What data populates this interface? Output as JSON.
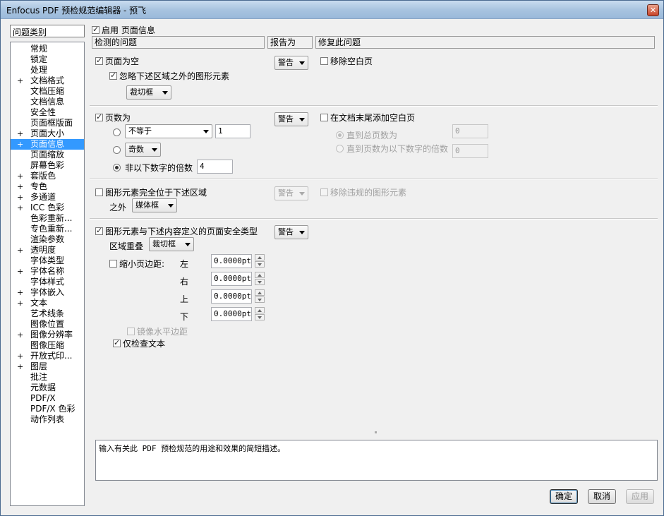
{
  "window": {
    "title": "Enfocus PDF 预检规范编辑器 - 预飞"
  },
  "sidebar": {
    "header": "问题类别",
    "items": [
      {
        "label": "常规",
        "exp": ""
      },
      {
        "label": "锁定",
        "exp": ""
      },
      {
        "label": "处理",
        "exp": ""
      },
      {
        "label": "文档格式",
        "exp": "+"
      },
      {
        "label": "文档压缩",
        "exp": ""
      },
      {
        "label": "文档信息",
        "exp": ""
      },
      {
        "label": "安全性",
        "exp": ""
      },
      {
        "label": "页面框版面",
        "exp": ""
      },
      {
        "label": "页面大小",
        "exp": "+"
      },
      {
        "label": "页面信息",
        "exp": "+",
        "selected": true
      },
      {
        "label": "页面缩放",
        "exp": ""
      },
      {
        "label": "屏幕色彩",
        "exp": ""
      },
      {
        "label": "套版色",
        "exp": "+"
      },
      {
        "label": "专色",
        "exp": "+"
      },
      {
        "label": "多通道",
        "exp": "+"
      },
      {
        "label": "ICC 色彩",
        "exp": "+"
      },
      {
        "label": "色彩重新...",
        "exp": ""
      },
      {
        "label": "专色重新...",
        "exp": ""
      },
      {
        "label": "渲染参数",
        "exp": ""
      },
      {
        "label": "透明度",
        "exp": "+"
      },
      {
        "label": "字体类型",
        "exp": ""
      },
      {
        "label": "字体名称",
        "exp": "+"
      },
      {
        "label": "字体样式",
        "exp": ""
      },
      {
        "label": "字体嵌入",
        "exp": "+"
      },
      {
        "label": "文本",
        "exp": "+"
      },
      {
        "label": "艺术线条",
        "exp": ""
      },
      {
        "label": "图像位置",
        "exp": ""
      },
      {
        "label": "图像分辨率",
        "exp": "+"
      },
      {
        "label": "图像压缩",
        "exp": ""
      },
      {
        "label": "开放式印...",
        "exp": "+"
      },
      {
        "label": "图层",
        "exp": "+"
      },
      {
        "label": "批注",
        "exp": ""
      },
      {
        "label": "元数据",
        "exp": ""
      },
      {
        "label": "PDF/X",
        "exp": ""
      },
      {
        "label": "PDF/X 色彩",
        "exp": ""
      },
      {
        "label": "动作列表",
        "exp": ""
      }
    ]
  },
  "main": {
    "enable_label": "启用 页面信息",
    "col_detect": "检测的问题",
    "col_report": "报告为",
    "col_fix": "修复此问题",
    "s1": {
      "check_label": "页面为空",
      "ignore_label": "忽略下述区域之外的图形元素",
      "box_select": "裁切框",
      "report": "警告",
      "fix_label": "移除空白页"
    },
    "s2": {
      "check_label": "页数为",
      "op_select": "不等于",
      "op_value": "1",
      "parity_select": "奇数",
      "multiple_label": "非以下数字的倍数",
      "multiple_value": "4",
      "report": "警告",
      "fix_label": "在文档末尾添加空白页",
      "until_total_label": "直到总页数为",
      "until_total_value": "0",
      "until_multiple_label": "直到页数为以下数字的倍数",
      "until_multiple_value": "0"
    },
    "s3": {
      "check_label": "图形元素完全位于下述区域",
      "outside_label": "之外",
      "box_select": "媒体框",
      "report": "警告",
      "fix_label": "移除违规的图形元素"
    },
    "s4": {
      "check_label": "图形元素与下述内容定义的页面安全类型",
      "overlap_label": "区域重叠",
      "box_select": "裁切框",
      "report": "警告",
      "shrink_label": "缩小页边距:",
      "left_label": "左",
      "right_label": "右",
      "top_label": "上",
      "bottom_label": "下",
      "left_value": "0.0000pt",
      "right_value": "0.0000pt",
      "top_value": "0.0000pt",
      "bottom_value": "0.0000pt",
      "mirror_label": "镜像水平边距",
      "text_only_label": "仅检查文本"
    },
    "description": "输入有关此 PDF 预检规范的用途和效果的简短描述。"
  },
  "buttons": {
    "ok": "确定",
    "cancel": "取消",
    "apply": "应用"
  }
}
